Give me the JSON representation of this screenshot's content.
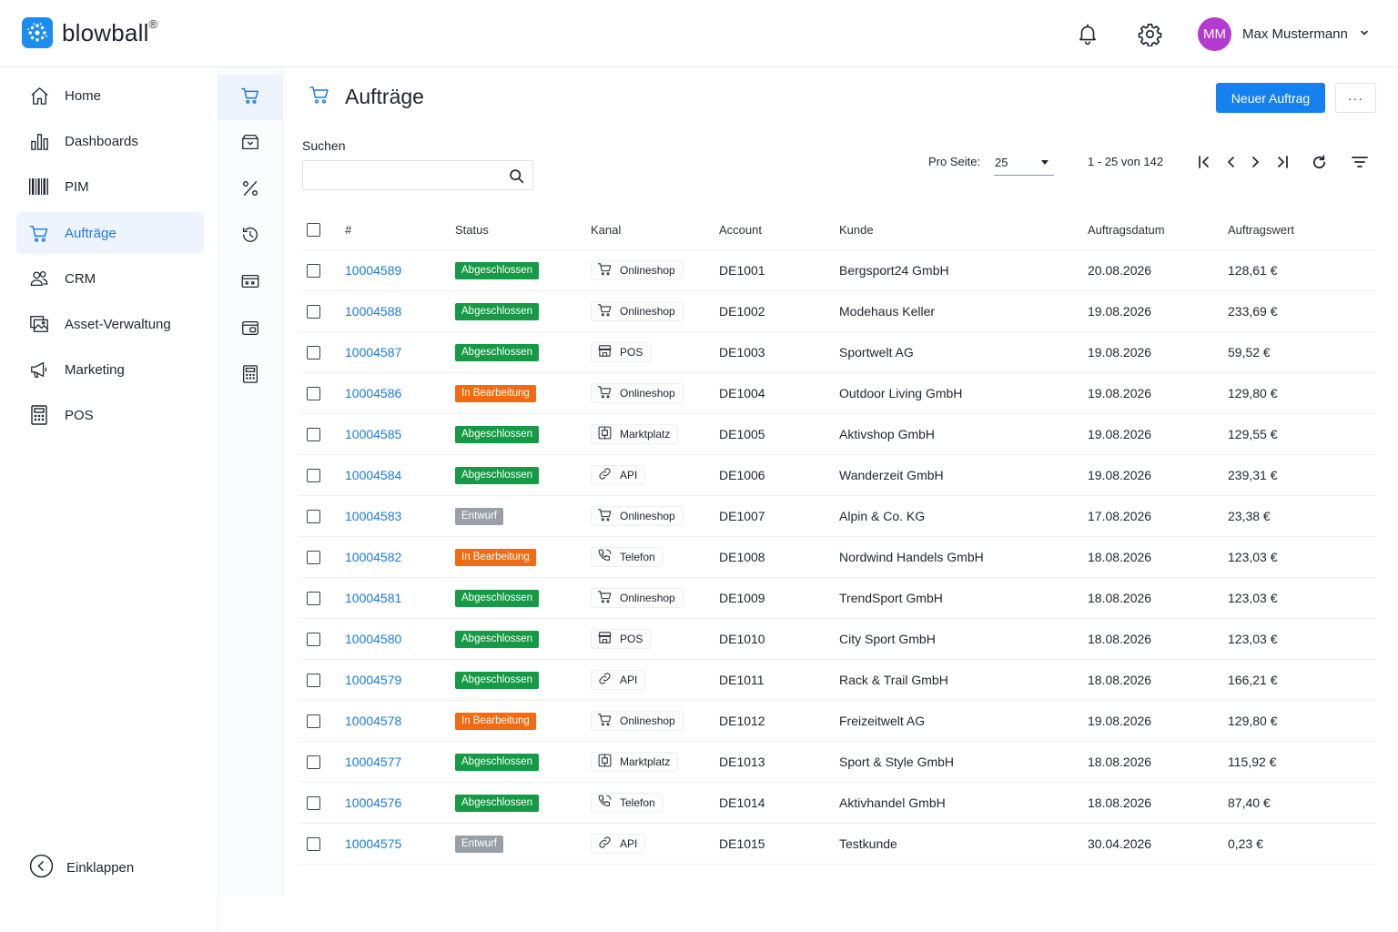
{
  "brand": {
    "name": "blowball",
    "reg": "®"
  },
  "user": {
    "initials": "MM",
    "name": "Max Mustermann"
  },
  "colors": {
    "accent": "#1580f0",
    "done": "#159a45",
    "progress": "#f26b12",
    "draft": "#9aa0a8",
    "avatar": "#b53ad0"
  },
  "sidebar": {
    "items": [
      {
        "label": "Home",
        "icon": "home-icon"
      },
      {
        "label": "Dashboards",
        "icon": "bar-chart-icon"
      },
      {
        "label": "PIM",
        "icon": "barcode-icon"
      },
      {
        "label": "Aufträge",
        "icon": "cart-icon",
        "active": true
      },
      {
        "label": "CRM",
        "icon": "users-icon"
      },
      {
        "label": "Asset-Verwaltung",
        "icon": "images-icon"
      },
      {
        "label": "Marketing",
        "icon": "megaphone-icon"
      },
      {
        "label": "POS",
        "icon": "calculator-icon"
      }
    ],
    "collapse_label": "Einklappen"
  },
  "rail": [
    "cart-icon",
    "box-icon",
    "percent-icon",
    "history-icon",
    "card-icon",
    "wallet-icon",
    "calculator-icon"
  ],
  "page": {
    "title": "Aufträge",
    "new_button": "Neuer Auftrag",
    "more_button": "···"
  },
  "search": {
    "label": "Suchen",
    "value": "",
    "placeholder": ""
  },
  "pagination": {
    "per_page_label": "Pro Seite:",
    "per_page": "25",
    "range": "1 - 25 von 142"
  },
  "table": {
    "columns": [
      "#",
      "Status",
      "Kanal",
      "Account",
      "Kunde",
      "Auftragsdatum",
      "Auftragswert"
    ],
    "rows": [
      {
        "id": "10004589",
        "status": "Abgeschlossen",
        "kind": "done",
        "channel": "Onlineshop",
        "ch": "cart",
        "account": "DE1001",
        "customer": "Bergsport24 GmbH",
        "date": "20.08.2026",
        "value": "128,61 €"
      },
      {
        "id": "10004588",
        "status": "Abgeschlossen",
        "kind": "done",
        "channel": "Onlineshop",
        "ch": "cart",
        "account": "DE1002",
        "customer": "Modehaus Keller",
        "date": "19.08.2026",
        "value": "233,69 €"
      },
      {
        "id": "10004587",
        "status": "Abgeschlossen",
        "kind": "done",
        "channel": "POS",
        "ch": "store",
        "account": "DE1003",
        "customer": "Sportwelt AG",
        "date": "19.08.2026",
        "value": "59,52 €"
      },
      {
        "id": "10004586",
        "status": "In Bearbeitung",
        "kind": "progress",
        "channel": "Onlineshop",
        "ch": "cart",
        "account": "DE1004",
        "customer": "Outdoor Living GmbH",
        "date": "19.08.2026",
        "value": "129,80 €"
      },
      {
        "id": "10004585",
        "status": "Abgeschlossen",
        "kind": "done",
        "channel": "Marktplatz",
        "ch": "market",
        "account": "DE1005",
        "customer": "Aktivshop GmbH",
        "date": "19.08.2026",
        "value": "129,55 €"
      },
      {
        "id": "10004584",
        "status": "Abgeschlossen",
        "kind": "done",
        "channel": "API",
        "ch": "link",
        "account": "DE1006",
        "customer": "Wanderzeit GmbH",
        "date": "19.08.2026",
        "value": "239,31 €"
      },
      {
        "id": "10004583",
        "status": "Entwurf",
        "kind": "draft",
        "channel": "Onlineshop",
        "ch": "cart",
        "account": "DE1007",
        "customer": "Alpin & Co. KG",
        "date": "17.08.2026",
        "value": "23,38 €"
      },
      {
        "id": "10004582",
        "status": "In Bearbeitung",
        "kind": "progress",
        "channel": "Telefon",
        "ch": "phone",
        "account": "DE1008",
        "customer": "Nordwind Handels GmbH",
        "date": "18.08.2026",
        "value": "123,03 €"
      },
      {
        "id": "10004581",
        "status": "Abgeschlossen",
        "kind": "done",
        "channel": "Onlineshop",
        "ch": "cart",
        "account": "DE1009",
        "customer": "TrendSport GmbH",
        "date": "18.08.2026",
        "value": "123,03 €"
      },
      {
        "id": "10004580",
        "status": "Abgeschlossen",
        "kind": "done",
        "channel": "POS",
        "ch": "store",
        "account": "DE1010",
        "customer": "City Sport GmbH",
        "date": "18.08.2026",
        "value": "123,03 €"
      },
      {
        "id": "10004579",
        "status": "Abgeschlossen",
        "kind": "done",
        "channel": "API",
        "ch": "link",
        "account": "DE1011",
        "customer": "Rack & Trail GmbH",
        "date": "18.08.2026",
        "value": "166,21 €"
      },
      {
        "id": "10004578",
        "status": "In Bearbeitung",
        "kind": "progress",
        "channel": "Onlineshop",
        "ch": "cart",
        "account": "DE1012",
        "customer": "Freizeitwelt AG",
        "date": "19.08.2026",
        "value": "129,80 €"
      },
      {
        "id": "10004577",
        "status": "Abgeschlossen",
        "kind": "done",
        "channel": "Marktplatz",
        "ch": "market",
        "account": "DE1013",
        "customer": "Sport & Style GmbH",
        "date": "18.08.2026",
        "value": "115,92 €"
      },
      {
        "id": "10004576",
        "status": "Abgeschlossen",
        "kind": "done",
        "channel": "Telefon",
        "ch": "phone",
        "account": "DE1014",
        "customer": "Aktivhandel GmbH",
        "date": "18.08.2026",
        "value": "87,40 €"
      },
      {
        "id": "10004575",
        "status": "Entwurf",
        "kind": "draft",
        "channel": "API",
        "ch": "link",
        "account": "DE1015",
        "customer": "Testkunde",
        "date": "30.04.2026",
        "value": "0,23 €"
      }
    ]
  }
}
